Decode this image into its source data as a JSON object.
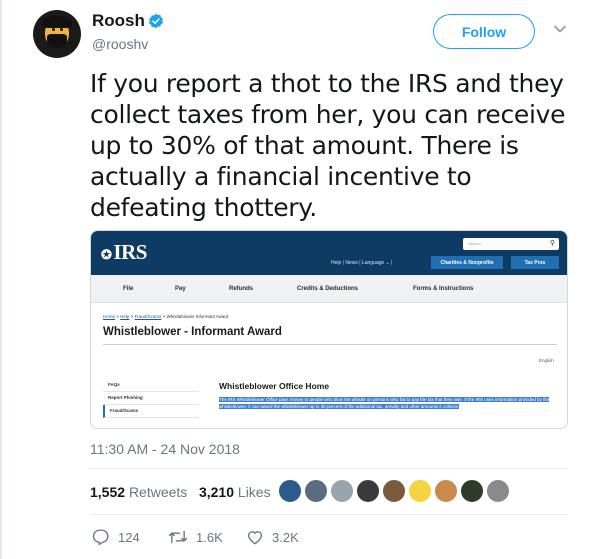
{
  "user": {
    "name": "Roosh",
    "handle": "@rooshv"
  },
  "follow_label": "Follow",
  "tweet": {
    "text": "If you report a thot to the IRS and they collect taxes from her, you can receive up to 30% of that amount. There is actually a financial incentive to defeating thottery."
  },
  "irs_page": {
    "logo": "IRS",
    "search_placeholder": "Search",
    "utility_links": "Help  |  News  |  Language ⌄  |",
    "charities_button": "Charities & Nonprofits",
    "tax_pros_button": "Tax Pros",
    "nav": [
      "File",
      "Pay",
      "Refunds",
      "Credits & Deductions",
      "Forms & Instructions"
    ],
    "breadcrumb": {
      "home": "Home",
      "help": "Help",
      "fraud": "Fraud/Scams",
      "current": "Whistleblower Informant Award"
    },
    "title": "Whistleblower - Informant Award",
    "language": "English",
    "sidebar": [
      "FAQs",
      "Report Phishing",
      "Fraud/Scams"
    ],
    "section_heading": "Whistleblower Office Home",
    "body_text": "The IRS Whistleblower Office pays money to people who blow the whistle on persons who fail to pay the tax that they owe. If the IRS uses information provided by the whistleblower, it can award the whistleblower up to 30 percent of the additional tax, penalty and other amounts it collects."
  },
  "timestamp": "11:30 AM - 24 Nov 2018",
  "stats": {
    "retweets": "1,552",
    "retweets_label": "Retweets",
    "likes": "3,210",
    "likes_label": "Likes"
  },
  "actions": {
    "replies": "124",
    "retweets": "1.6K",
    "likes": "3.2K"
  },
  "colors": {
    "twitter_blue": "#1da1f2",
    "irs_navy": "#0e3b63",
    "muted": "#657786"
  }
}
